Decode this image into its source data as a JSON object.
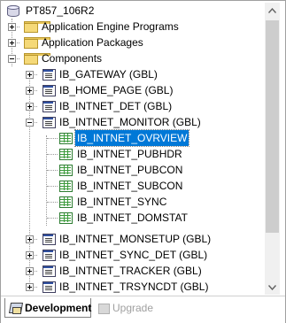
{
  "tree": {
    "root": {
      "label": "PT857_106R2",
      "icon": "database-icon"
    },
    "folders": [
      {
        "label": "Application Engine Programs",
        "expanded": false
      },
      {
        "label": "Application Packages",
        "expanded": false
      },
      {
        "label": "Components",
        "expanded": true
      }
    ],
    "components_before": [
      {
        "label": "IB_GATEWAY (GBL)"
      },
      {
        "label": "IB_HOME_PAGE (GBL)"
      },
      {
        "label": "IB_INTNET_DET (GBL)"
      },
      {
        "label": "IB_INTNET_MONITOR (GBL)",
        "expanded": true
      }
    ],
    "pages": [
      {
        "label": "IB_INTNET_OVRVIEW",
        "selected": true
      },
      {
        "label": "IB_INTNET_PUBHDR"
      },
      {
        "label": "IB_INTNET_PUBCON"
      },
      {
        "label": "IB_INTNET_SUBCON"
      },
      {
        "label": "IB_INTNET_SYNC"
      },
      {
        "label": "IB_INTNET_DOMSTAT"
      }
    ],
    "components_after": [
      {
        "label": "IB_INTNET_MONSETUP (GBL)"
      },
      {
        "label": "IB_INTNET_SYNC_DET (GBL)"
      },
      {
        "label": "IB_INTNET_TRACKER (GBL)"
      },
      {
        "label": "IB_INTNET_TRSYNCDT (GBL)"
      }
    ]
  },
  "tabs": {
    "development": "Development",
    "upgrade": "Upgrade"
  },
  "colors": {
    "selection": "#0078d7",
    "folder": "#f5d978",
    "page_icon": "#3a9a3a"
  }
}
